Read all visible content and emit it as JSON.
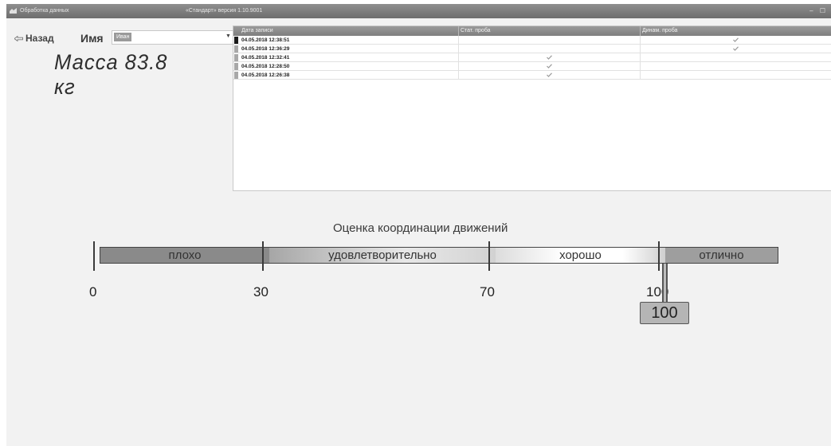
{
  "window": {
    "title": "Обработка данных",
    "version": "«Стандарт» версия 1.10.9001",
    "controls": "– ☐"
  },
  "header": {
    "back_label": "Назад",
    "name_label": "Имя",
    "name_value": "Иван",
    "mass_text": "Масса 83.8 кг"
  },
  "records": {
    "columns": [
      "Дата записи",
      "Стат. проба",
      "Динам. проба"
    ],
    "rows": [
      {
        "date": "04.05.2018 12:38:51",
        "stat": false,
        "dyn": true,
        "active": true
      },
      {
        "date": "04.05.2018 12:36:29",
        "stat": false,
        "dyn": true,
        "active": false
      },
      {
        "date": "04.05.2018 12:32:41",
        "stat": true,
        "dyn": false,
        "active": false
      },
      {
        "date": "04.05.2018 12:28:50",
        "stat": true,
        "dyn": false,
        "active": false
      },
      {
        "date": "04.05.2018 12:26:38",
        "stat": true,
        "dyn": false,
        "active": false
      }
    ]
  },
  "scale": {
    "title": "Оценка координации движений",
    "segments": [
      "плохо",
      "удовлетворительно",
      "хорошо",
      "отлично"
    ],
    "ticks": [
      "0",
      "30",
      "70",
      "100"
    ],
    "value": "100"
  }
}
